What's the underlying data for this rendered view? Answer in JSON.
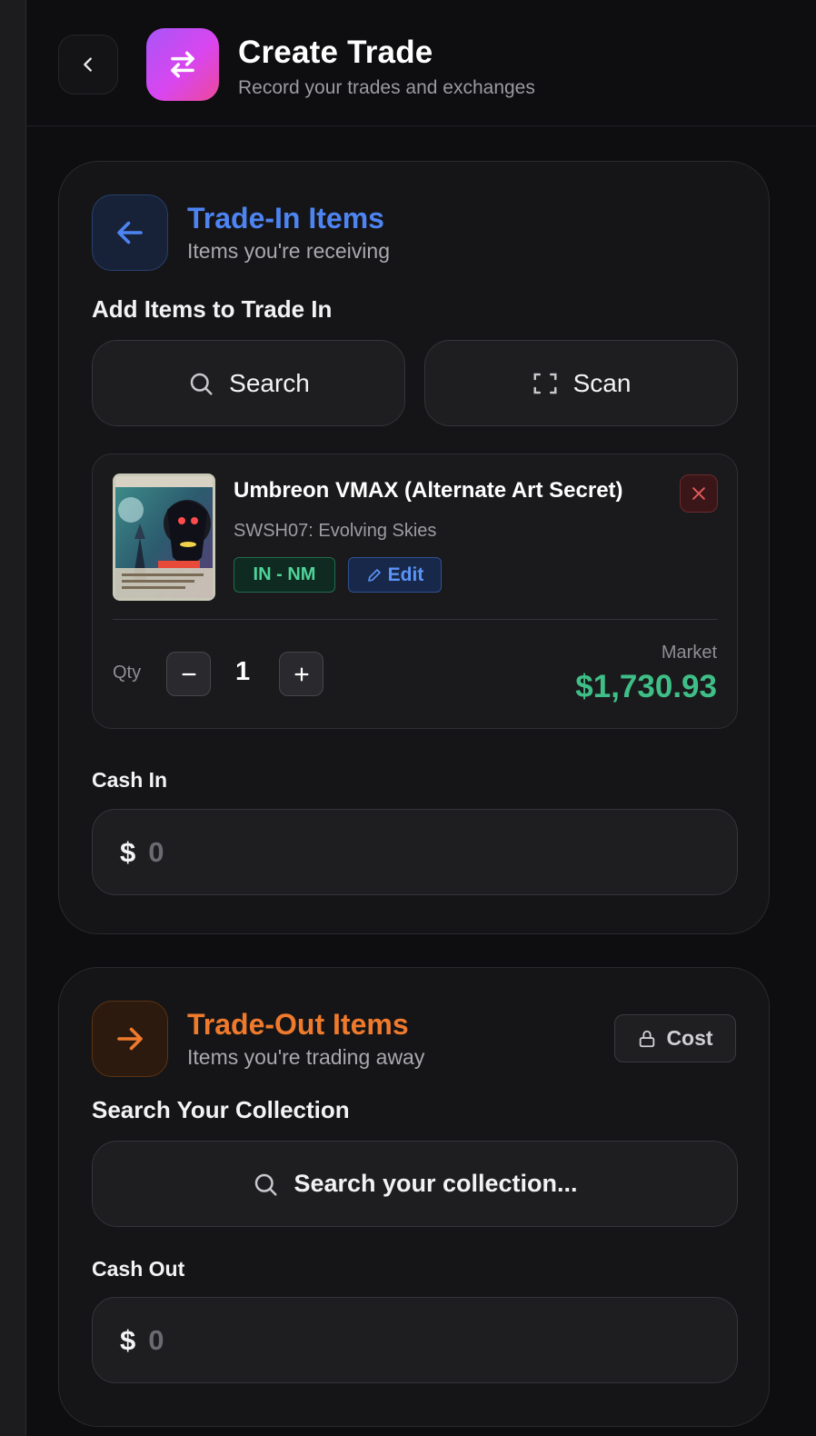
{
  "header": {
    "title": "Create Trade",
    "subtitle": "Record your trades and exchanges"
  },
  "trade_in": {
    "title": "Trade-In Items",
    "subtitle": "Items you're receiving",
    "add_label": "Add Items to Trade In",
    "search_label": "Search",
    "scan_label": "Scan",
    "item": {
      "name": "Umbreon VMAX (Alternate Art Secret)",
      "set": "SWSH07: Evolving Skies",
      "condition": "IN - NM",
      "edit_label": "Edit",
      "qty_label": "Qty",
      "qty": "1",
      "market_label": "Market",
      "market_value": "$1,730.93"
    },
    "cash_label": "Cash In",
    "cash_symbol": "$",
    "cash_placeholder": "0"
  },
  "trade_out": {
    "title": "Trade-Out Items",
    "subtitle": "Items you're trading away",
    "cost_label": "Cost",
    "search_section_label": "Search Your Collection",
    "search_placeholder": "Search your collection...",
    "cash_label": "Cash Out",
    "cash_symbol": "$",
    "cash_placeholder": "0"
  },
  "colors": {
    "accent_in": "#4d84f2",
    "accent_out": "#f07a2c",
    "market_green": "#3fbf87",
    "condition_green": "#4fd39a",
    "remove_red": "#e05a5a"
  }
}
